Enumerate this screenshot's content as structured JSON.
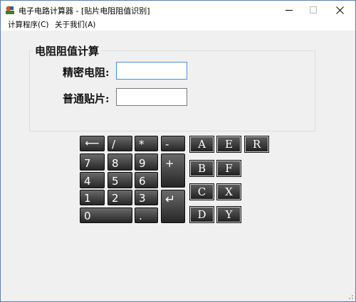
{
  "window": {
    "title": "电子电路计算器 - [贴片电阻阻值识别]"
  },
  "menu": {
    "items": [
      "计算程序(C)",
      "关于我们(A)"
    ]
  },
  "group": {
    "title": "电阻阻值计算",
    "fields": [
      {
        "label": "精密电阻:",
        "value": ""
      },
      {
        "label": "普通贴片:",
        "value": ""
      }
    ]
  },
  "keypad": {
    "backspace": "⟵",
    "divide": "/",
    "multiply": "*",
    "minus": "-",
    "plus": "+",
    "enter": "↵",
    "digits": {
      "7": "7",
      "8": "8",
      "9": "9",
      "4": "4",
      "5": "5",
      "6": "6",
      "1": "1",
      "2": "2",
      "3": "3",
      "0": "0"
    },
    "dot": "."
  },
  "letters": [
    "A",
    "E",
    "R",
    "B",
    "F",
    "C",
    "X",
    "D",
    "Y"
  ],
  "colors": {
    "key_bg": "#3a3a3a",
    "window_border": "#5a7fb0",
    "focus_border": "#4a90d9"
  }
}
